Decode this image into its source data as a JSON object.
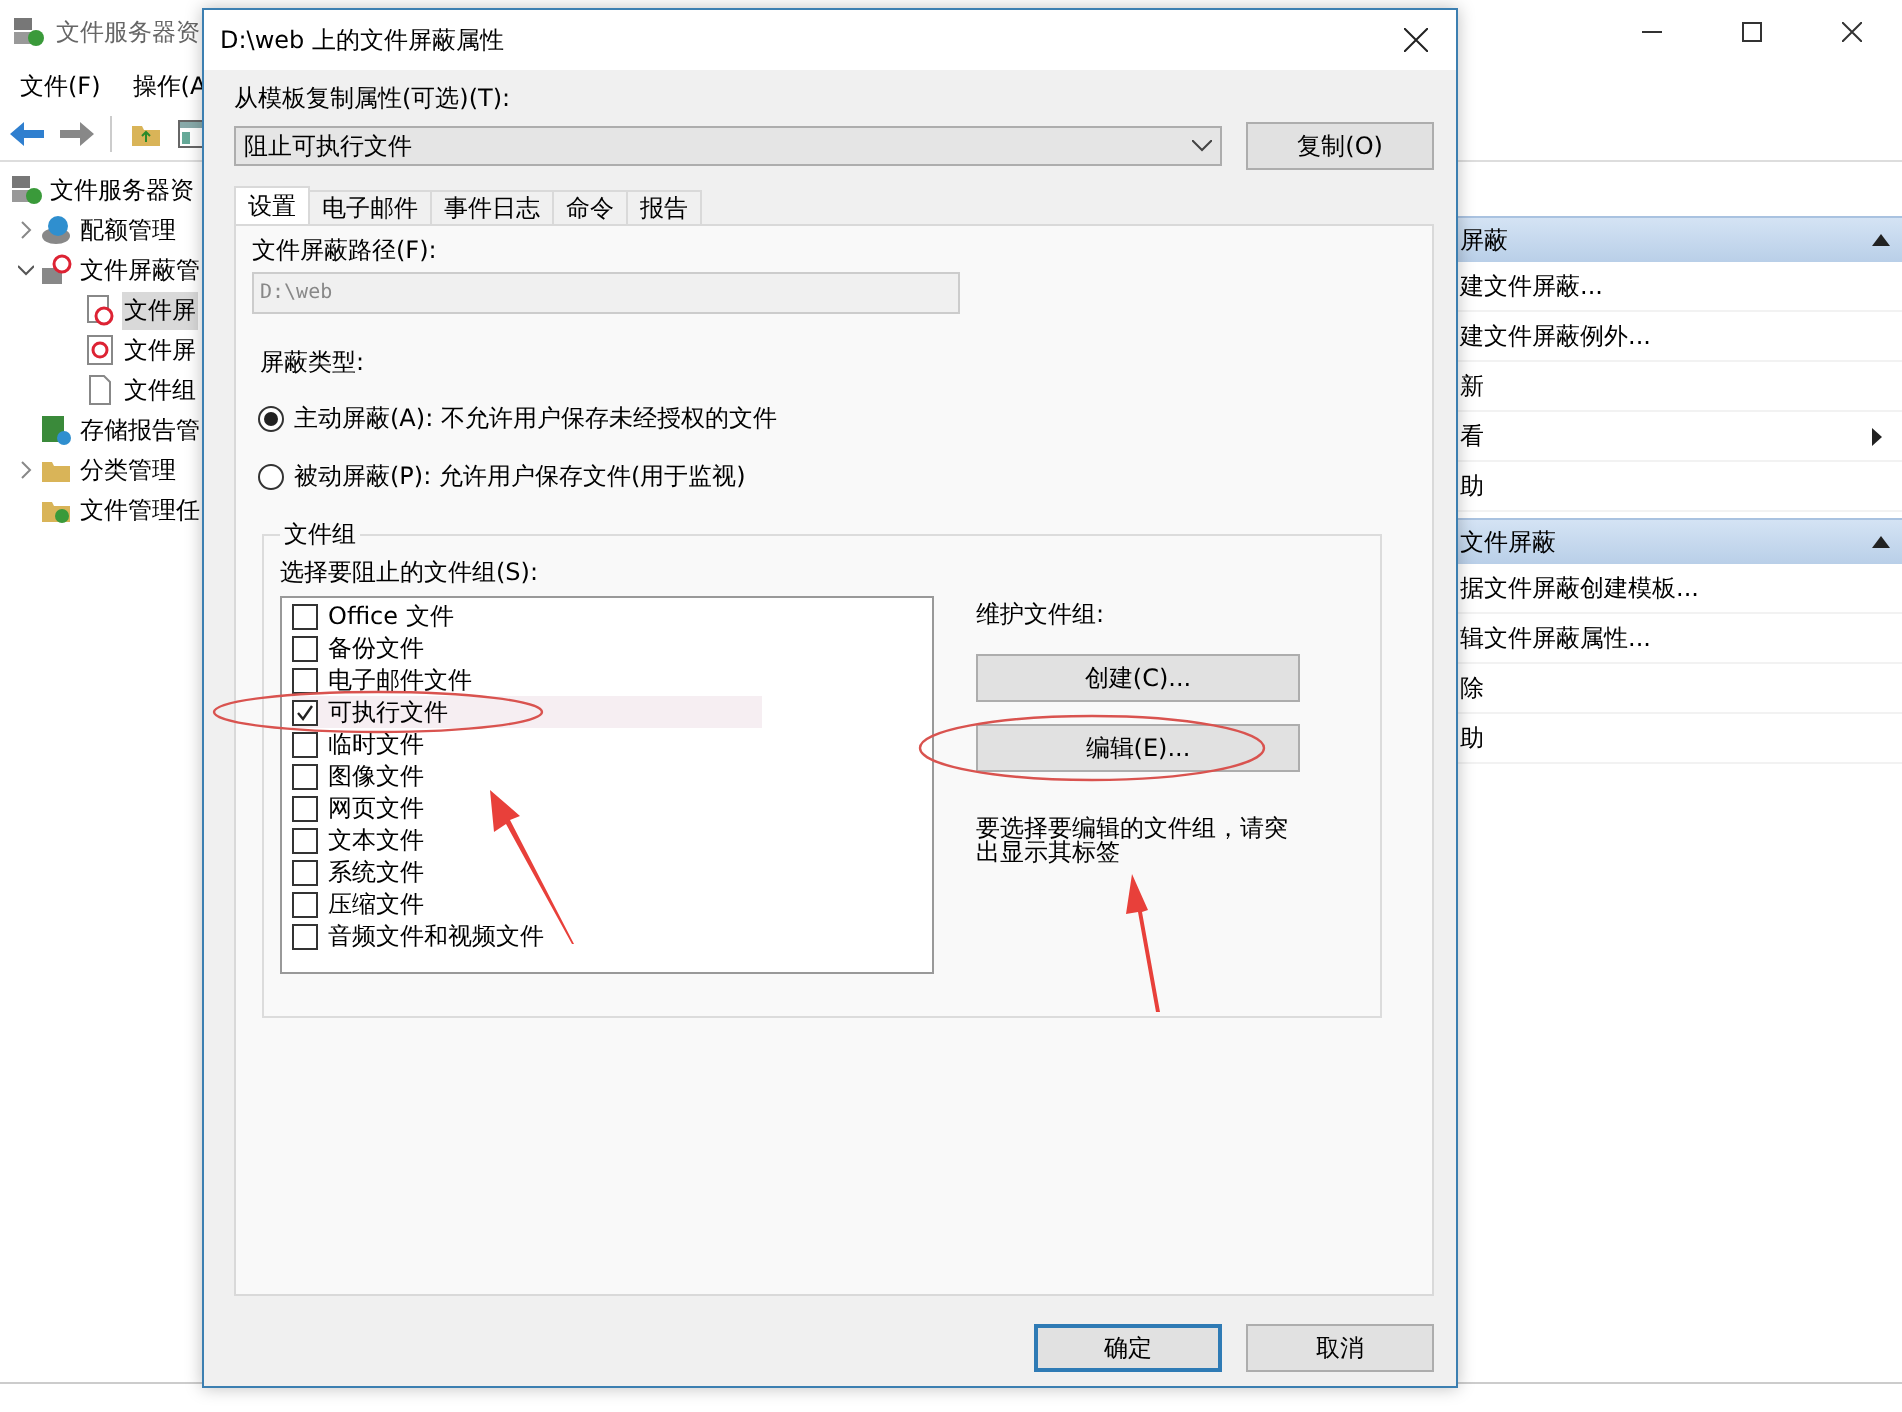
{
  "background_window": {
    "title": "文件服务器资",
    "menu": [
      "文件(F)",
      "操作(A"
    ],
    "tree": [
      {
        "label": "文件服务器资",
        "selected": false,
        "children": [
          {
            "label": "配额管理",
            "expanded": false,
            "selected": false
          },
          {
            "label": "文件屏蔽管",
            "expanded": true,
            "selected": false,
            "children": [
              {
                "label": "文件屏",
                "selected": true
              },
              {
                "label": "文件屏",
                "selected": false
              },
              {
                "label": "文件组",
                "selected": false
              }
            ]
          },
          {
            "label": "存储报告管",
            "selected": false
          },
          {
            "label": "分类管理",
            "expanded": false,
            "selected": false
          },
          {
            "label": "文件管理任",
            "selected": false
          }
        ]
      }
    ],
    "actions": [
      {
        "kind": "header",
        "label": "屏蔽"
      },
      {
        "kind": "item",
        "label": "建文件屏蔽..."
      },
      {
        "kind": "item",
        "label": "建文件屏蔽例外..."
      },
      {
        "kind": "item",
        "label": "新"
      },
      {
        "kind": "submenu",
        "label": "看"
      },
      {
        "kind": "item",
        "label": "助"
      },
      {
        "kind": "header",
        "label": "文件屏蔽"
      },
      {
        "kind": "item",
        "label": "据文件屏蔽创建模板..."
      },
      {
        "kind": "item",
        "label": "辑文件屏蔽属性..."
      },
      {
        "kind": "item",
        "label": "除"
      },
      {
        "kind": "item",
        "label": "助"
      }
    ]
  },
  "dialog": {
    "title": "D:\\web 上的文件屏蔽属性",
    "template_label": "从模板复制属性(可选)(T):",
    "template_value": "阻止可执行文件",
    "copy_button": "复制(O)",
    "tabs": [
      {
        "label": "设置",
        "selected": true
      },
      {
        "label": "电子邮件",
        "selected": false
      },
      {
        "label": "事件日志",
        "selected": false
      },
      {
        "label": "命令",
        "selected": false
      },
      {
        "label": "报告",
        "selected": false
      }
    ],
    "path_label": "文件屏蔽路径(F):",
    "path": {
      "value": "D:\\web",
      "disabled": true
    },
    "screen_type_label": "屏蔽类型:",
    "screen_types": [
      {
        "label": "主动屏蔽(A): 不允许用户保存未经授权的文件",
        "selected": true
      },
      {
        "label": "被动屏蔽(P): 允许用户保存文件(用于监视)",
        "selected": false
      }
    ],
    "file_groups": {
      "title": "文件组",
      "list_label": "选择要阻止的文件组(S):",
      "items": [
        {
          "label": "Office 文件",
          "checked": false,
          "selected": false
        },
        {
          "label": "备份文件",
          "checked": false,
          "selected": false
        },
        {
          "label": "电子邮件文件",
          "checked": false,
          "selected": false
        },
        {
          "label": "可执行文件",
          "checked": true,
          "selected": true
        },
        {
          "label": "临时文件",
          "checked": false,
          "selected": false
        },
        {
          "label": "图像文件",
          "checked": false,
          "selected": false
        },
        {
          "label": "网页文件",
          "checked": false,
          "selected": false
        },
        {
          "label": "文本文件",
          "checked": false,
          "selected": false
        },
        {
          "label": "系统文件",
          "checked": false,
          "selected": false
        },
        {
          "label": "压缩文件",
          "checked": false,
          "selected": false
        },
        {
          "label": "音频文件和视频文件",
          "checked": false,
          "selected": false
        }
      ],
      "maintain_label": "维护文件组:",
      "buttons": [
        "创建(C)...",
        "编辑(E)..."
      ],
      "hint": "要选择要编辑的文件组，请突出显示其标签"
    },
    "buttons": [
      {
        "label": "确定",
        "default": true
      },
      {
        "label": "取消",
        "default": false
      }
    ]
  }
}
